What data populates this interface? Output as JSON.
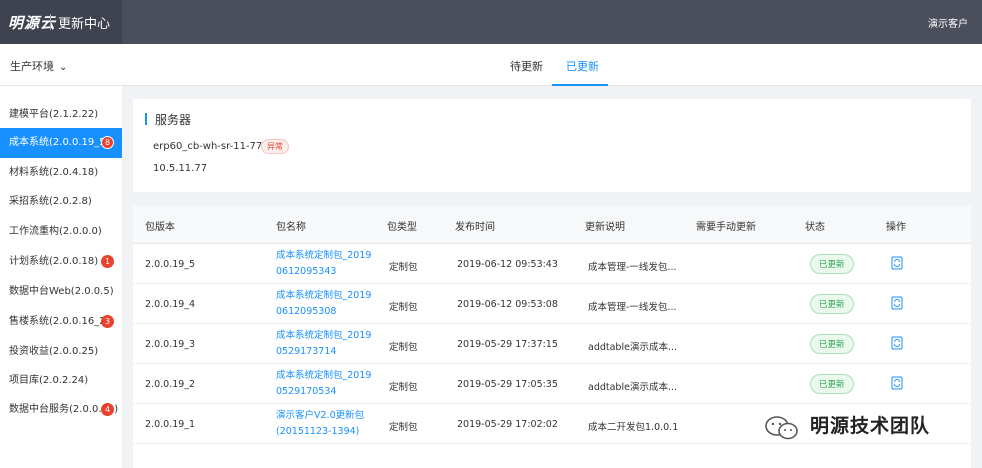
{
  "header": {
    "logo": "明源云",
    "app_title": "更新中心",
    "user": "演示客户"
  },
  "subbar": {
    "environment": "生产环境",
    "tabs": [
      {
        "label": "待更新",
        "active": false
      },
      {
        "label": "已更新",
        "active": true
      }
    ]
  },
  "sidebar": {
    "items": [
      {
        "label": "建模平台(2.1.2.22)",
        "badge": ""
      },
      {
        "label": "成本系统(2.0.0.19_5)",
        "badge": "8"
      },
      {
        "label": "材料系统(2.0.4.18)",
        "badge": ""
      },
      {
        "label": "采招系统(2.0.2.8)",
        "badge": ""
      },
      {
        "label": "工作流重构(2.0.0.0)",
        "badge": ""
      },
      {
        "label": "计划系统(2.0.0.18)",
        "badge": "1"
      },
      {
        "label": "数据中台Web(2.0.0.5)",
        "badge": ""
      },
      {
        "label": "售楼系统(2.0.0.16_2)",
        "badge": "3"
      },
      {
        "label": "投资收益(2.0.0.25)",
        "badge": ""
      },
      {
        "label": "项目库(2.0.2.24)",
        "badge": ""
      },
      {
        "label": "数据中台服务(2.0.0.13)",
        "badge": "4"
      }
    ]
  },
  "server": {
    "title": "服务器",
    "host": "erp60_cb-wh-sr-11-77 ...",
    "status": "异常",
    "ip": "10.5.11.77"
  },
  "table": {
    "columns": [
      "包版本",
      "包名称",
      "包类型",
      "发布时间",
      "更新说明",
      "需要手动更新",
      "状态",
      "操作"
    ],
    "rows": [
      {
        "version": "2.0.0.19_5",
        "pkg_line1": "成本系统定制包_2019",
        "pkg_line2": "0612095343",
        "type": "定制包",
        "time": "2019-06-12 09:53:43",
        "desc": "成本管理-一线发包...",
        "state": "已更新"
      },
      {
        "version": "2.0.0.19_4",
        "pkg_line1": "成本系统定制包_2019",
        "pkg_line2": "0612095308",
        "type": "定制包",
        "time": "2019-06-12 09:53:08",
        "desc": "成本管理-一线发包...",
        "state": "已更新"
      },
      {
        "version": "2.0.0.19_3",
        "pkg_line1": "成本系统定制包_2019",
        "pkg_line2": "0529173714",
        "type": "定制包",
        "time": "2019-05-29 17:37:15",
        "desc": "addtable演示成本...",
        "state": "已更新"
      },
      {
        "version": "2.0.0.19_2",
        "pkg_line1": "成本系统定制包_2019",
        "pkg_line2": "0529170534",
        "type": "定制包",
        "time": "2019-05-29 17:05:35",
        "desc": "addtable演示成本...",
        "state": "已更新"
      },
      {
        "version": "2.0.0.19_1",
        "pkg_line1": "演示客户V2.0更新包",
        "pkg_line2": "(20151123-1394)",
        "type": "定制包",
        "time": "2019-05-29 17:02:02",
        "desc": "成本二开发包1.0.0.1",
        "state": ""
      }
    ]
  },
  "watermark": {
    "text": "明源技术团队"
  },
  "colors": {
    "primary": "#1890ff",
    "header_bg": "#4b4f5c",
    "badge_red": "#e8412c",
    "status_green": "#2ea44f"
  }
}
